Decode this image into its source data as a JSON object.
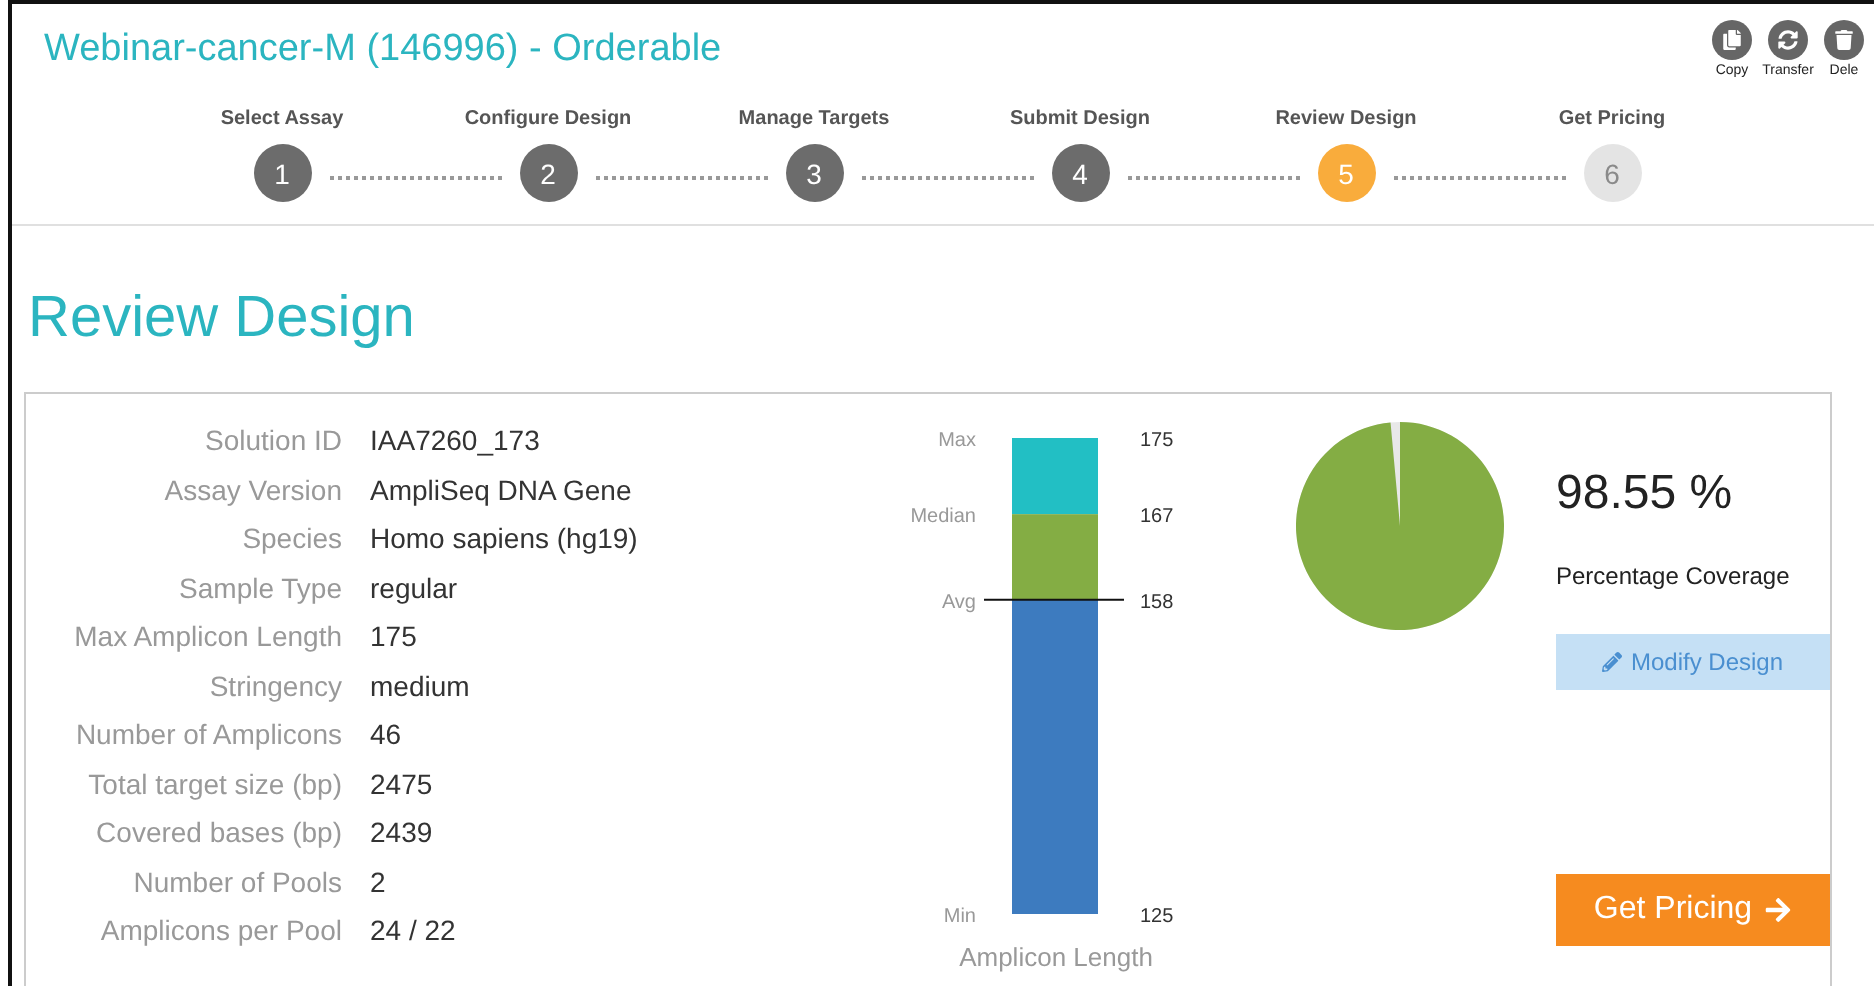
{
  "title": "Webinar-cancer-M (146996) - Orderable",
  "toolbar": [
    {
      "kind": "copy",
      "label": "Copy"
    },
    {
      "kind": "transfer",
      "label": "Transfer"
    },
    {
      "kind": "delete",
      "label": "Dele"
    }
  ],
  "steps": [
    {
      "number": "1",
      "label": "Select Assay",
      "selected": false,
      "disabled": false
    },
    {
      "number": "2",
      "label": "Configure Design",
      "selected": false,
      "disabled": false
    },
    {
      "number": "3",
      "label": "Manage Targets",
      "selected": false,
      "disabled": false
    },
    {
      "number": "4",
      "label": "Submit Design",
      "selected": false,
      "disabled": false
    },
    {
      "number": "5",
      "label": "Review Design",
      "selected": true,
      "disabled": false
    },
    {
      "number": "6",
      "label": "Get Pricing",
      "selected": false,
      "disabled": true
    }
  ],
  "heading": "Review Design",
  "details": [
    {
      "label": "Solution ID",
      "value": "IAA7260_173"
    },
    {
      "label": "Assay Version",
      "value": "AmpliSeq DNA Gene"
    },
    {
      "label": "Species",
      "value": "Homo sapiens (hg19)"
    },
    {
      "label": "Sample Type",
      "value": "regular"
    },
    {
      "label": "Max Amplicon Length",
      "value": "175"
    },
    {
      "label": "Stringency",
      "value": "medium"
    },
    {
      "label": "Number of Amplicons",
      "value": "46"
    },
    {
      "label": "Total target size (bp)",
      "value": "2475"
    },
    {
      "label": "Covered bases (bp)",
      "value": "2439"
    },
    {
      "label": "Number of Pools",
      "value": "2"
    },
    {
      "label": "Amplicons per Pool",
      "value": "24 / 22"
    }
  ],
  "amplicon_length": {
    "title": "Amplicon Length",
    "markers": [
      {
        "label": "Max",
        "value": "175"
      },
      {
        "label": "Median",
        "value": "167"
      },
      {
        "label": "Avg",
        "value": "158",
        "kind": "line"
      },
      {
        "label": "Min",
        "value": "125"
      }
    ],
    "segments": [
      {
        "color": "#22bfc4"
      },
      {
        "color": "#84ad44"
      },
      {
        "color": "#3d7bbf"
      }
    ]
  },
  "coverage": {
    "value": "98.55 %",
    "label": "Percentage Coverage"
  },
  "buttons": {
    "modify": "Modify Design",
    "pricing": "Get Pricing"
  }
}
